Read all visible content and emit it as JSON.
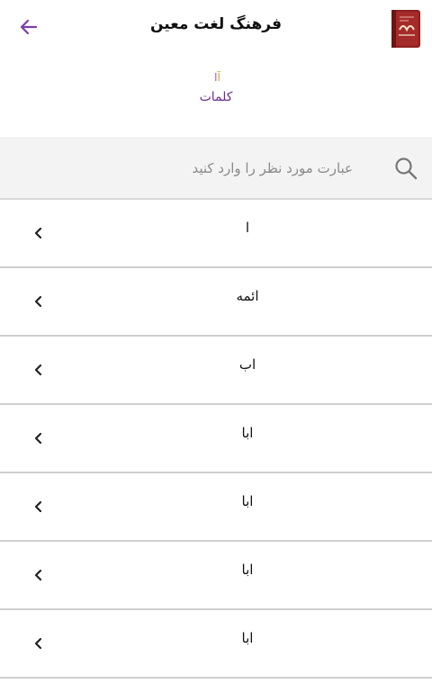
{
  "header": {
    "title": "فرهنگ لغت معین",
    "back_icon": "arrow-left-icon",
    "logo_icon": "moein-book-logo",
    "accent_color": "#7b3fa6"
  },
  "breadcrumb": {
    "letter_1": "آ",
    "letter_2": "ا",
    "section": "کلمات"
  },
  "search": {
    "placeholder": "عبارت مورد نظر را وارد کنید",
    "value": "",
    "icon": "search-icon"
  },
  "list": {
    "items": [
      {
        "label": "ا"
      },
      {
        "label": "ائمه"
      },
      {
        "label": "اب"
      },
      {
        "label": "ابا"
      },
      {
        "label": "ابا"
      },
      {
        "label": "ابا"
      },
      {
        "label": "ابا"
      }
    ],
    "chevron_icon": "chevron-left-icon"
  }
}
